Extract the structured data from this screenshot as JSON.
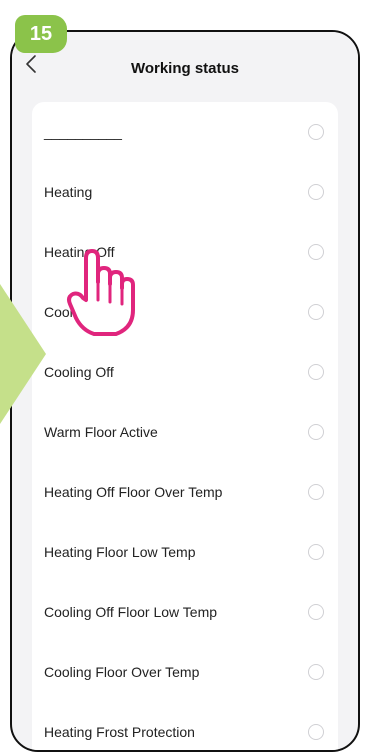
{
  "step_number": "15",
  "header": {
    "title": "Working status",
    "back_icon": "chevron-left-icon"
  },
  "colors": {
    "step_badge": "#8bc34a",
    "arrow": "#c5e08a",
    "hand_cursor": "#e0257d",
    "background": "#f3f3f5",
    "card": "#ffffff"
  },
  "options": [
    {
      "label": "__________",
      "selected": false
    },
    {
      "label": "Heating",
      "selected": false
    },
    {
      "label": "Heating Off",
      "selected": false
    },
    {
      "label": "Cooling",
      "selected": false
    },
    {
      "label": "Cooling Off",
      "selected": false
    },
    {
      "label": "Warm Floor Active",
      "selected": false
    },
    {
      "label": "Heating Off Floor Over Temp",
      "selected": false
    },
    {
      "label": "Heating Floor Low Temp",
      "selected": false
    },
    {
      "label": "Cooling Off Floor Low Temp",
      "selected": false
    },
    {
      "label": "Cooling Floor Over Temp",
      "selected": false
    },
    {
      "label": "Heating Frost Protection",
      "selected": false
    }
  ]
}
